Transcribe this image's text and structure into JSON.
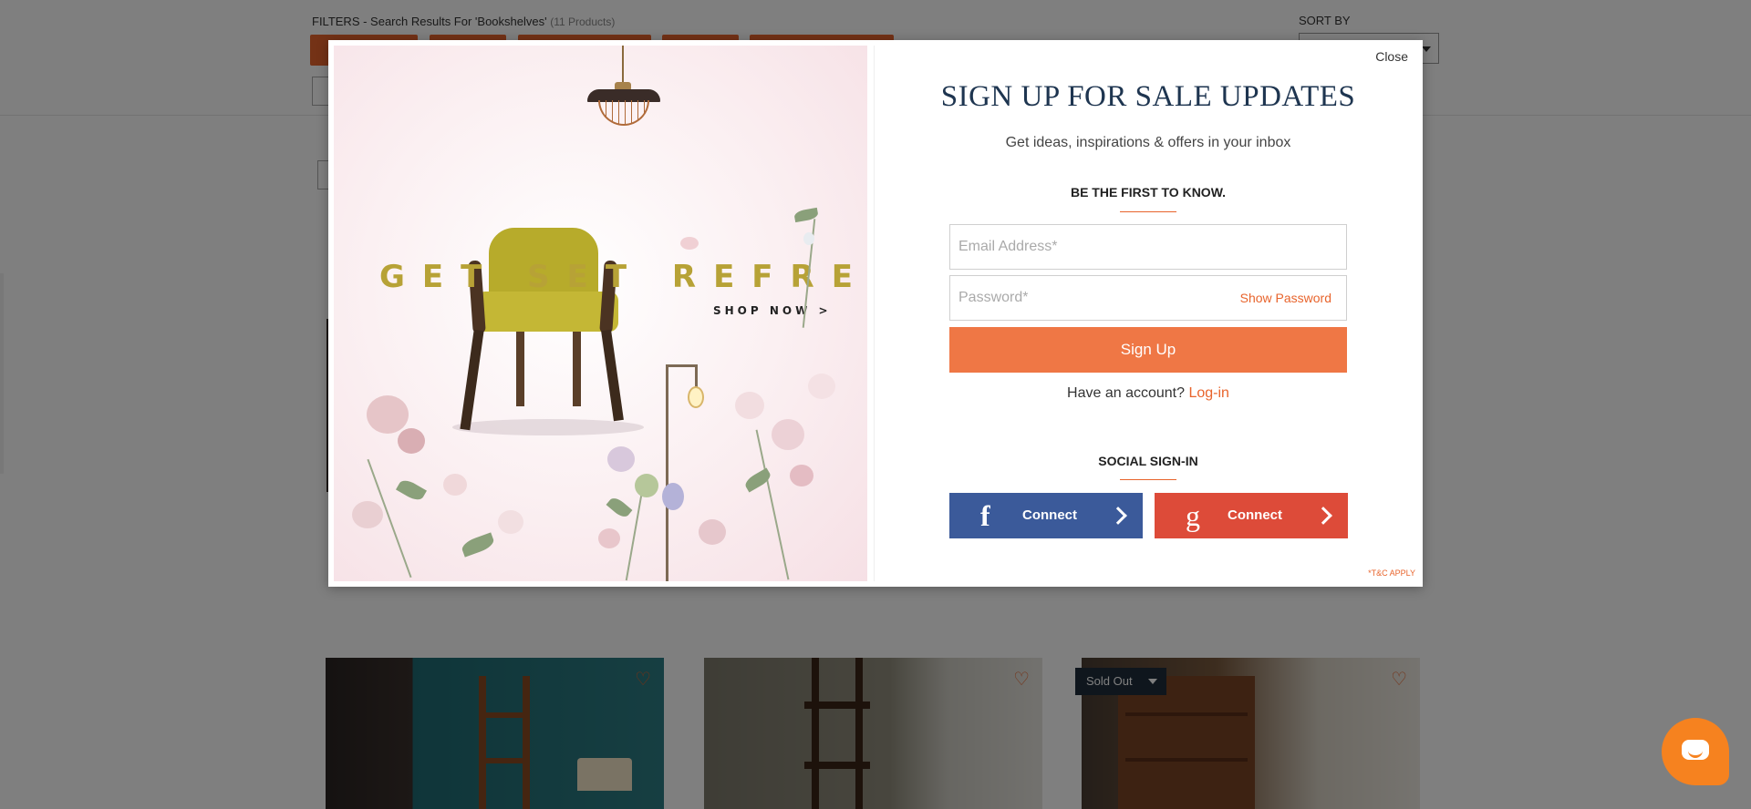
{
  "background": {
    "filters_label": "FILTERS - Search Results For 'Bookshelves'",
    "products_count": "(11 Products)",
    "sort_by_label": "SORT BY",
    "sold_out_label": "Sold Out",
    "colors": {
      "accent": "#e8642c",
      "overlay": "rgba(0,0,0,0.5)"
    }
  },
  "modal": {
    "close_label": "Close",
    "title": "SIGN UP FOR SALE UPDATES",
    "subtitle": "Get ideas, inspirations & offers in your inbox",
    "first_to_know": "BE THE FIRST TO KNOW.",
    "email_placeholder": "Email Address*",
    "password_placeholder": "Password*",
    "show_password_label": "Show Password",
    "signup_label": "Sign Up",
    "have_account_text": "Have an account?",
    "login_label": "Log-in",
    "social_title": "SOCIAL SIGN-IN",
    "facebook": {
      "glyph": "f",
      "label": "Connect",
      "color": "#3b5a9a"
    },
    "google": {
      "glyph": "g",
      "label": "Connect",
      "color": "#dd4b39"
    },
    "tc_note": "*T&C APPLY",
    "promo": {
      "headline": "GET SET REFRESH",
      "cta": "SHOP NOW >"
    },
    "colors": {
      "title": "#1e3550",
      "signup_button": "#ef7745",
      "link": "#e8642c"
    }
  },
  "icons": [
    "heart-icon",
    "facebook-icon",
    "google-icon",
    "chevron-right-icon",
    "chat-icon",
    "caret-down-icon"
  ]
}
